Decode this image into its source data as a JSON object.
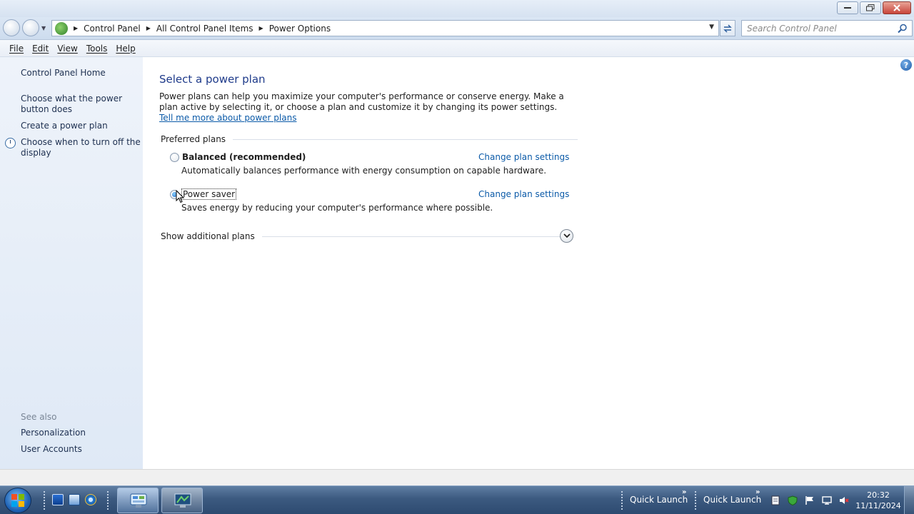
{
  "window": {
    "caption_buttons": [
      "minimize",
      "maximize",
      "close"
    ]
  },
  "address_bar": {
    "crumbs": [
      "Control Panel",
      "All Control Panel Items",
      "Power Options"
    ],
    "search_placeholder": "Search Control Panel"
  },
  "menu": {
    "items": [
      "File",
      "Edit",
      "View",
      "Tools",
      "Help"
    ]
  },
  "sidebar": {
    "home": "Control Panel Home",
    "links": [
      "Choose what the power button does",
      "Create a power plan",
      "Choose when to turn off the display"
    ],
    "see_also_label": "See also",
    "see_also": [
      "Personalization",
      "User Accounts"
    ]
  },
  "main": {
    "title": "Select a power plan",
    "intro": "Power plans can help you maximize your computer's performance or conserve energy. Make a plan active by selecting it, or choose a plan and customize it by changing its power settings.",
    "intro_link": "Tell me more about power plans",
    "preferred_header": "Preferred plans",
    "plans": [
      {
        "name": "Balanced (recommended)",
        "description": "Automatically balances performance with energy consumption on capable hardware.",
        "change_link": "Change plan settings",
        "selected": false
      },
      {
        "name": "Power saver",
        "description": "Saves energy by reducing your computer's performance where possible.",
        "change_link": "Change plan settings",
        "selected": true
      }
    ],
    "additional_header": "Show additional plans"
  },
  "taskbar": {
    "quick_launch_labels": [
      "Quick Launch",
      "Quick Launch"
    ],
    "clock_time": "20:32",
    "clock_date": "11/11/2024"
  },
  "colors": {
    "link": "#0b5aa8",
    "title": "#1e3a8a",
    "sidebar_bg": "#e6eef8"
  }
}
